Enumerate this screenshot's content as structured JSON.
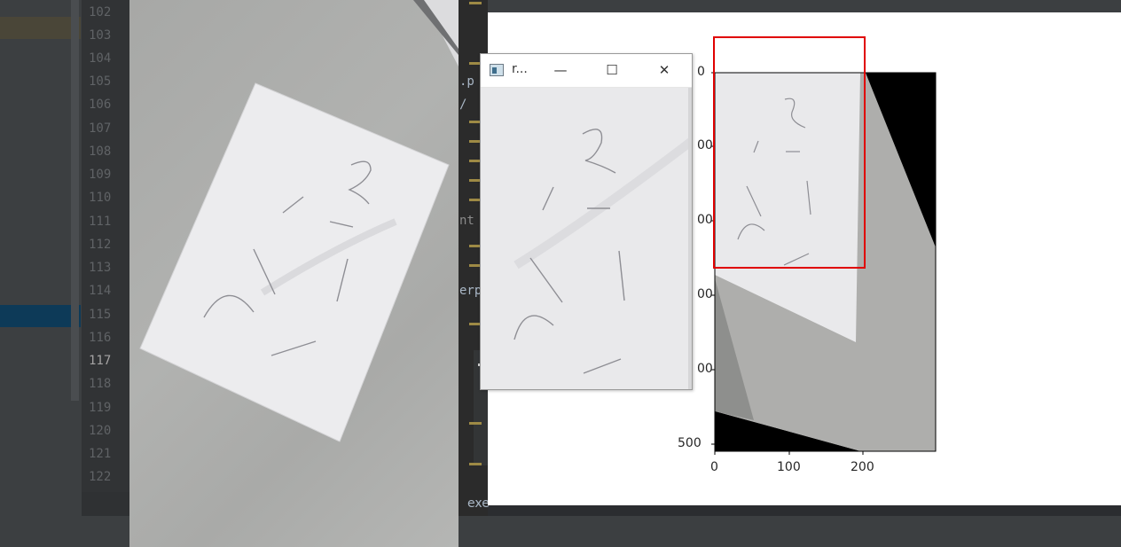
{
  "editor": {
    "line_numbers": [
      "102",
      "103",
      "104",
      "105",
      "106",
      "107",
      "108",
      "109",
      "110",
      "111",
      "112",
      "113",
      "114",
      "115",
      "116",
      "117",
      "118",
      "119",
      "120",
      "121",
      "122"
    ],
    "current_line": "117",
    "code_fragments": [
      {
        "text": ".p"
      },
      {
        "text": "/"
      },
      {
        "text": "nt"
      },
      {
        "text": "erp"
      }
    ],
    "exec_label": "exe"
  },
  "cv_window": {
    "title": "r...",
    "minimize_glyph": "—",
    "maximize_glyph": "☐",
    "close_glyph": "✕"
  },
  "plot": {
    "x_ticks": [
      "0",
      "100",
      "200"
    ],
    "y_ticks": [
      "0",
      "100",
      "200",
      "300",
      "400",
      "500"
    ],
    "x_ticks_visible": [
      "0",
      "100",
      "200"
    ],
    "y_ticks_visible": [
      "0",
      "00",
      "00",
      "00",
      "00",
      "500"
    ],
    "rect_color": "#e00000"
  },
  "colors": {
    "ide_bg": "#2b2d30",
    "gutter": "#313335",
    "paper": "#ececee"
  }
}
